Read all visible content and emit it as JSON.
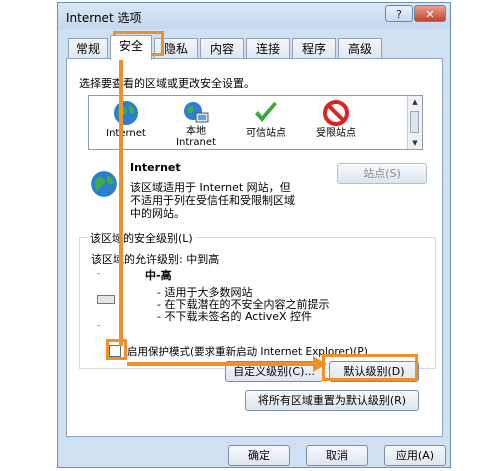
{
  "window": {
    "title": "Internet 选项",
    "help_label": "?",
    "close_label": "✕"
  },
  "tabs": [
    {
      "label": "常规"
    },
    {
      "label": "安全"
    },
    {
      "label": "隐私"
    },
    {
      "label": "内容"
    },
    {
      "label": "连接"
    },
    {
      "label": "程序"
    },
    {
      "label": "高级"
    }
  ],
  "security": {
    "prompt": "选择要查看的区域或更改安全设置。",
    "zones": [
      {
        "label": "Internet",
        "icon": "globe-icon"
      },
      {
        "label": "本地\nIntranet",
        "icon": "intranet-icon"
      },
      {
        "label": "可信站点",
        "icon": "check-icon"
      },
      {
        "label": "受限站点",
        "icon": "restricted-icon"
      }
    ],
    "zone_title": "Internet",
    "zone_desc_1": "该区域适用于 Internet 网站，但",
    "zone_desc_2": "不适用于列在受信任和受限制区域",
    "zone_desc_3": "中的网站。",
    "sites_button": "站点(S)",
    "level_group_title": "该区域的安全级别(L)",
    "allowed_levels": "该区域的允许级别: 中到高",
    "level_name": "中-高",
    "level_desc_1": "- 适用于大多数网站",
    "level_desc_2": "- 在下载潜在的不安全内容之前提示",
    "level_desc_3": "- 不下载未签名的 ActiveX 控件",
    "protected_mode": "启用保护模式(要求重新启动 Internet Explorer)(P)",
    "custom_level_button": "自定义级别(C)...",
    "default_level_button": "默认级别(D)",
    "reset_all_button": "将所有区域重置为默认级别(R)"
  },
  "footer": {
    "ok": "确定",
    "cancel": "取消",
    "apply": "应用(A)"
  },
  "colors": {
    "annotation": "#f0902a",
    "accent": "#cfe0f2"
  }
}
